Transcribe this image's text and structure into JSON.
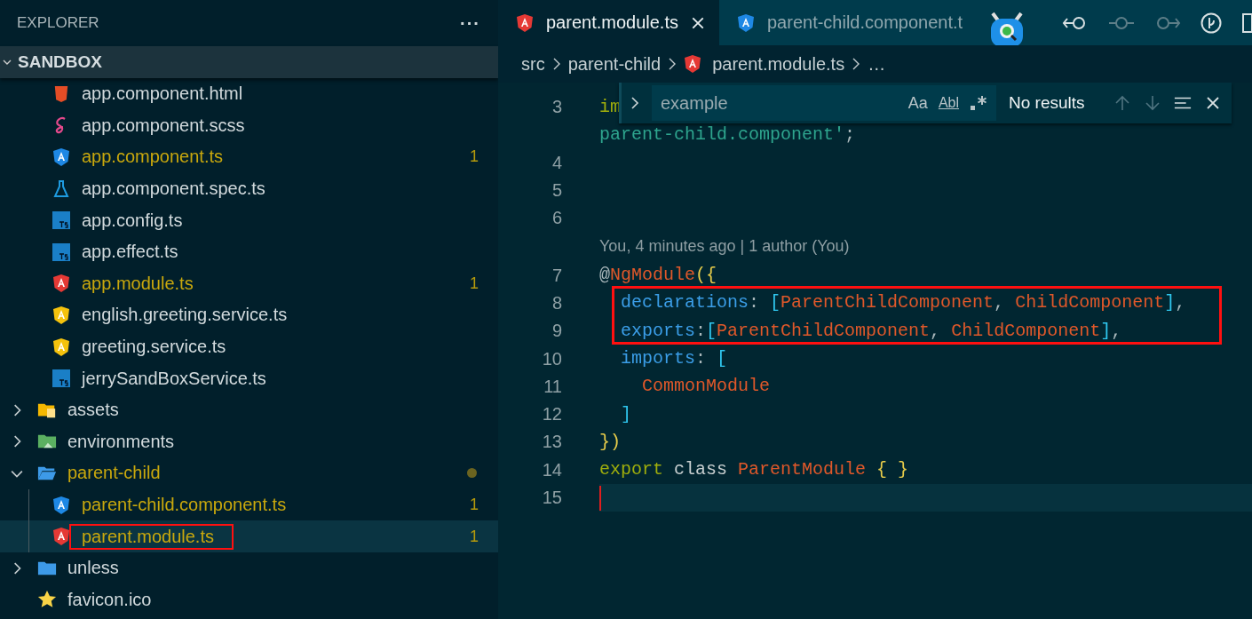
{
  "sidebar": {
    "title": "EXPLORER",
    "more": "···",
    "section": {
      "label": "SANDBOX",
      "expanded": true
    },
    "tree": [
      {
        "children": [
          {
            "label": "app.component.html",
            "kind": "html",
            "modified": false,
            "selected": false,
            "boxed": false
          },
          {
            "label": "app.component.scss",
            "kind": "sass",
            "modified": false,
            "selected": false,
            "boxed": false
          },
          {
            "label": "app.component.ts",
            "kind": "angular",
            "modified": true,
            "badge": "1",
            "selected": false,
            "boxed": false
          },
          {
            "label": "app.component.spec.ts",
            "kind": "test",
            "modified": false,
            "selected": false,
            "boxed": false
          },
          {
            "label": "app.config.ts",
            "kind": "ts",
            "modified": false,
            "selected": false,
            "boxed": false
          },
          {
            "label": "app.effect.ts",
            "kind": "ts",
            "modified": false,
            "selected": false,
            "boxed": false
          },
          {
            "label": "app.module.ts",
            "kind": "angular-red",
            "modified": true,
            "badge": "1",
            "selected": false,
            "boxed": false
          },
          {
            "label": "english.greeting.service.ts",
            "kind": "angular-yellow",
            "modified": false,
            "selected": false,
            "boxed": false
          },
          {
            "label": "greeting.service.ts",
            "kind": "angular-yellow",
            "modified": false,
            "selected": false,
            "boxed": false
          },
          {
            "label": "jerrySandBoxService.ts",
            "kind": "ts",
            "modified": false,
            "selected": false,
            "boxed": false
          }
        ]
      },
      {
        "label": "assets",
        "kind": "folder-assets",
        "expanded": false,
        "modified": false,
        "selected": false,
        "boxed": false
      },
      {
        "label": "environments",
        "kind": "folder-env",
        "expanded": false,
        "modified": false,
        "selected": false,
        "boxed": false
      },
      {
        "label": "parent-child",
        "kind": "folder",
        "expanded": true,
        "modified": true,
        "dot": true,
        "selected": false,
        "boxed": false,
        "children": [
          {
            "label": "parent-child.component.ts",
            "kind": "angular",
            "modified": true,
            "badge": "1",
            "selected": false,
            "boxed": false
          },
          {
            "label": "parent.module.ts",
            "kind": "angular-red",
            "modified": true,
            "badge": "1",
            "selected": true,
            "boxed": true
          }
        ]
      },
      {
        "label": "unless",
        "kind": "folder",
        "expanded": false,
        "modified": false,
        "selected": false,
        "boxed": false
      },
      {
        "label": "favicon.ico",
        "kind": "star",
        "modified": false,
        "selected": false,
        "boxed": false
      }
    ]
  },
  "tabs": [
    {
      "label": "parent.module.ts",
      "kind": "angular-red",
      "selected": true
    },
    {
      "label": "parent-child.component.t",
      "kind": "angular",
      "selected": false
    }
  ],
  "toolbar": [
    {
      "kind": "back",
      "disabled": false
    },
    {
      "kind": "line",
      "disabled": true
    },
    {
      "kind": "forward",
      "disabled": true
    },
    {
      "kind": "branch",
      "disabled": false
    },
    {
      "kind": "split",
      "disabled": false
    }
  ],
  "breadcrumb": [
    {
      "label": "src"
    },
    {
      "label": "parent-child"
    },
    {
      "label": "parent.module.ts",
      "kind": "angular-red"
    },
    {
      "label": "…"
    }
  ],
  "find": {
    "value": "example",
    "options": [
      "Aa",
      "Abl"
    ],
    "result": "No results"
  },
  "code": [
    {
      "kind": "code",
      "number": "3",
      "tokens": [
        {
          "t": "im",
          "kind": "keyword"
        }
      ]
    },
    {
      "kind": "wrap",
      "tokens": [
        {
          "t": "parent-child.component'",
          "kind": "string"
        },
        {
          "t": ";",
          "kind": "punct"
        }
      ]
    },
    {
      "kind": "code",
      "number": "4"
    },
    {
      "kind": "code",
      "number": "5"
    },
    {
      "kind": "code",
      "number": "6"
    },
    {
      "kind": "codelens",
      "text": "You, 4 minutes ago | 1 author (You)"
    },
    {
      "kind": "code",
      "number": "7",
      "tokens": [
        {
          "t": "@",
          "kind": "punct"
        },
        {
          "t": "NgModule",
          "kind": "class"
        },
        {
          "t": "({",
          "kind": "brace"
        }
      ]
    },
    {
      "kind": "code",
      "number": "8",
      "boxed": true,
      "tokens": [
        {
          "t": "  declarations",
          "kind": "prop"
        },
        {
          "t": ": ",
          "kind": "punct"
        },
        {
          "t": "[",
          "kind": "bracket"
        },
        {
          "t": "ParentChildComponent",
          "kind": "class"
        },
        {
          "t": ", ",
          "kind": "punct"
        },
        {
          "t": "ChildComponent",
          "kind": "class"
        },
        {
          "t": "]",
          "kind": "bracket"
        },
        {
          "t": ",",
          "kind": "punct"
        }
      ]
    },
    {
      "kind": "code",
      "number": "9",
      "boxed": true,
      "tokens": [
        {
          "t": "  exports",
          "kind": "prop"
        },
        {
          "t": ":",
          "kind": "punct"
        },
        {
          "t": "[",
          "kind": "bracket"
        },
        {
          "t": "ParentChildComponent",
          "kind": "class"
        },
        {
          "t": ", ",
          "kind": "punct"
        },
        {
          "t": "ChildComponent",
          "kind": "class"
        },
        {
          "t": "]",
          "kind": "bracket"
        },
        {
          "t": ",",
          "kind": "punct"
        }
      ]
    },
    {
      "kind": "code",
      "number": "10",
      "tokens": [
        {
          "t": "  imports",
          "kind": "prop"
        },
        {
          "t": ": ",
          "kind": "punct"
        },
        {
          "t": "[",
          "kind": "bracket"
        }
      ]
    },
    {
      "kind": "code",
      "number": "11",
      "tokens": [
        {
          "t": "    CommonModule",
          "kind": "class"
        }
      ]
    },
    {
      "kind": "code",
      "number": "12",
      "tokens": [
        {
          "t": "  ]",
          "kind": "bracket"
        }
      ]
    },
    {
      "kind": "code",
      "number": "13",
      "tokens": [
        {
          "t": "})",
          "kind": "brace"
        }
      ]
    },
    {
      "kind": "code",
      "number": "14",
      "tokens": [
        {
          "t": "export",
          "kind": "keyword"
        },
        {
          "t": " class",
          "kind": "storage"
        },
        {
          "t": " ParentModule",
          "kind": "class"
        },
        {
          "t": " { }",
          "kind": "brace"
        }
      ]
    },
    {
      "kind": "code",
      "number": "15",
      "current": true
    }
  ]
}
